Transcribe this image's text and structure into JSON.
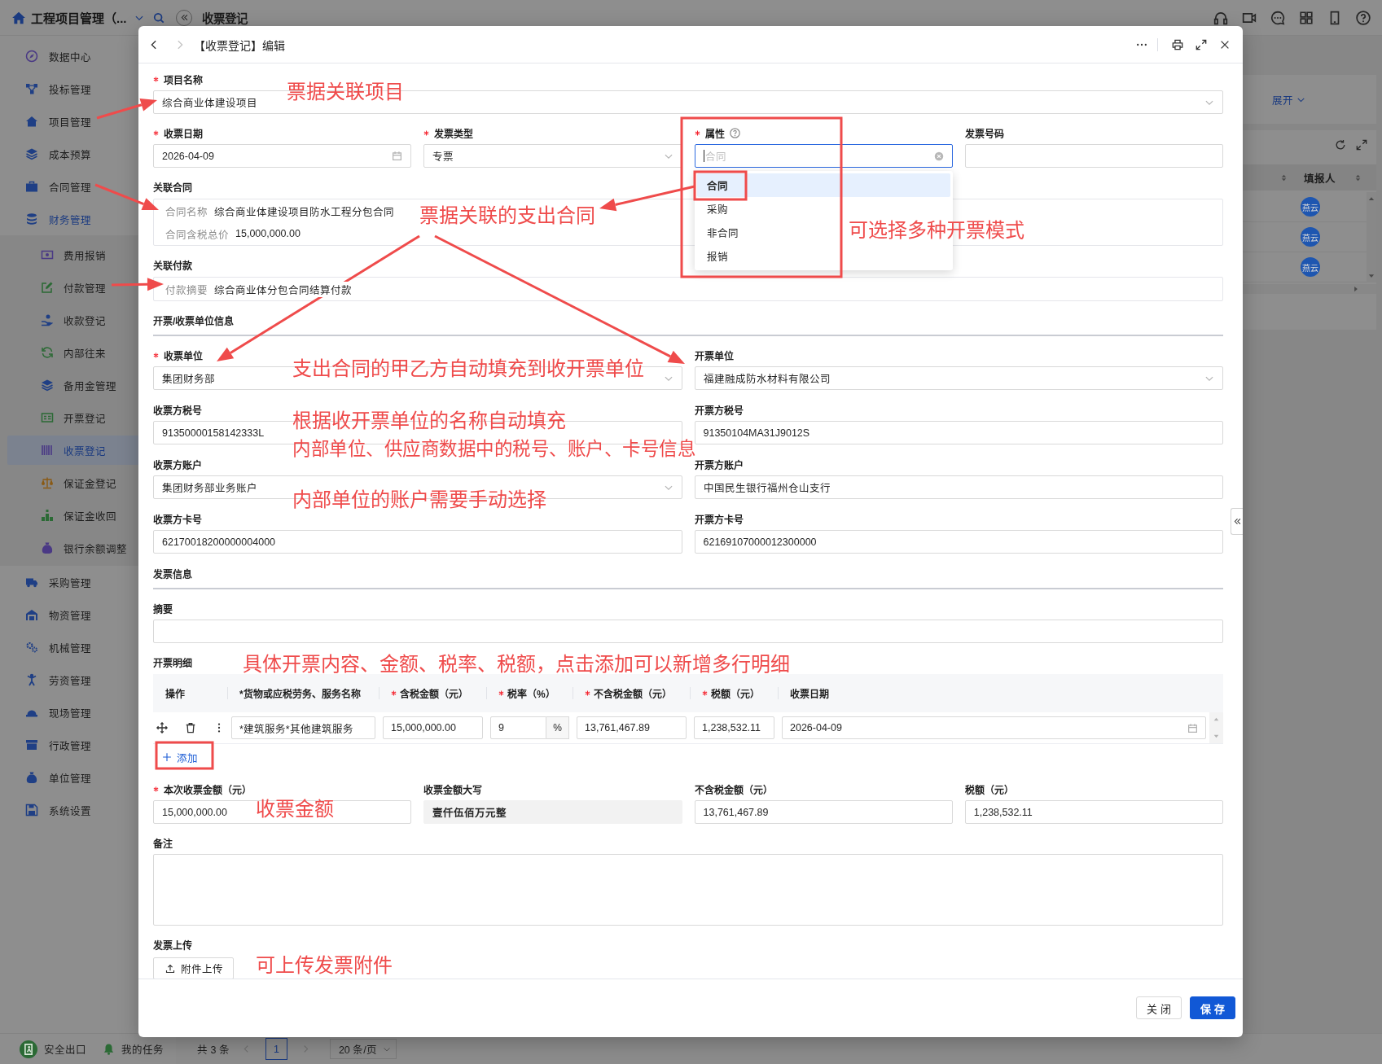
{
  "app": {
    "title": "工程项目管理（...",
    "page_title": "收票登记"
  },
  "sidebar": {
    "items": [
      {
        "label": "数据中心",
        "selected": false
      },
      {
        "label": "投标管理",
        "selected": false
      },
      {
        "label": "项目管理",
        "selected": false
      },
      {
        "label": "成本预算",
        "selected": false
      },
      {
        "label": "合同管理",
        "selected": false
      },
      {
        "label": "财务管理",
        "selected": false,
        "children": [
          {
            "label": "费用报销",
            "selected": false
          },
          {
            "label": "付款管理",
            "selected": false
          },
          {
            "label": "收款登记",
            "selected": false
          },
          {
            "label": "内部往来",
            "selected": false
          },
          {
            "label": "备用金管理",
            "selected": false
          },
          {
            "label": "开票登记",
            "selected": false
          },
          {
            "label": "收票登记",
            "selected": true
          },
          {
            "label": "保证金登记",
            "selected": false
          },
          {
            "label": "保证金收回",
            "selected": false
          },
          {
            "label": "银行余额调整",
            "selected": false
          }
        ]
      },
      {
        "label": "采购管理",
        "selected": false
      },
      {
        "label": "物资管理",
        "selected": false
      },
      {
        "label": "机械管理",
        "selected": false
      },
      {
        "label": "劳资管理",
        "selected": false
      },
      {
        "label": "现场管理",
        "selected": false
      },
      {
        "label": "行政管理",
        "selected": false
      },
      {
        "label": "单位管理",
        "selected": false
      },
      {
        "label": "系统设置",
        "selected": false
      }
    ],
    "footer": [
      {
        "label": "安全出口"
      },
      {
        "label": "我的任务"
      }
    ]
  },
  "list_page": {
    "filter_toggle": "展开",
    "table": {
      "columns": [
        {
          "label": "填报人"
        }
      ],
      "rows": [
        {
          "reporter": "燕云"
        },
        {
          "reporter": "燕云"
        },
        {
          "reporter": "燕云"
        }
      ]
    },
    "pagination": {
      "total": "共 3 条",
      "prev_disabled": true,
      "pages": [
        {
          "label": "1",
          "selected": true
        }
      ],
      "next_disabled": true,
      "page_size": "20 条/页"
    }
  },
  "dialog": {
    "title": "【收票登记】编辑",
    "history": [
      {
        "kind": "back",
        "disabled": false
      },
      {
        "kind": "forward",
        "disabled": true
      }
    ],
    "blocks": [
      {
        "kind": "fields",
        "fields": [
          {
            "kind": "select",
            "label": "项目名称",
            "required": true,
            "value": "综合商业体建设项目"
          }
        ]
      },
      {
        "kind": "fields",
        "fields": [
          {
            "kind": "date",
            "label": "收票日期",
            "required": true,
            "help": false,
            "value": "2026-04-09"
          },
          {
            "kind": "select",
            "label": "发票类型",
            "required": true,
            "help": false,
            "value": "专票"
          },
          {
            "kind": "search_select",
            "label": "属性",
            "required": true,
            "help": true,
            "placeholder": "合同",
            "focused": true,
            "open": true,
            "options": [
              {
                "label": "合同",
                "selected": true
              },
              {
                "label": "采购",
                "selected": false
              },
              {
                "label": "非合同",
                "selected": false
              },
              {
                "label": "报销",
                "selected": false
              }
            ]
          },
          {
            "kind": "text",
            "label": "发票号码",
            "required": false,
            "help": false
          }
        ]
      },
      {
        "kind": "info",
        "label": "关联合同",
        "items": [
          {
            "label": "合同名称",
            "value": "综合商业体建设项目防水工程分包合同"
          },
          {
            "label": "合同含税总价",
            "value": "15,000,000.00"
          }
        ]
      },
      {
        "kind": "info",
        "label": "关联付款",
        "items": [
          {
            "label": "付款摘要",
            "value": "综合商业体分包合同结算付款"
          }
        ]
      },
      {
        "kind": "section",
        "title": "开票/收票单位信息"
      },
      {
        "kind": "fields",
        "fields": [
          {
            "kind": "select",
            "label": "收票单位",
            "required": true,
            "value": "集团财务部"
          },
          {
            "kind": "select",
            "label": "开票单位",
            "required": false,
            "value": "福建融成防水材料有限公司"
          }
        ]
      },
      {
        "kind": "fields",
        "fields": [
          {
            "kind": "text",
            "label": "收票方税号",
            "required": false,
            "value": "91350000158142333L"
          },
          {
            "kind": "text",
            "label": "开票方税号",
            "required": false,
            "value": "91350104MA31J9012S"
          }
        ]
      },
      {
        "kind": "fields",
        "fields": [
          {
            "kind": "select",
            "label": "收票方账户",
            "required": false,
            "value": "集团财务部业务账户"
          },
          {
            "kind": "text",
            "label": "开票方账户",
            "required": false,
            "value": "中国民生银行福州仓山支行"
          }
        ]
      },
      {
        "kind": "fields",
        "fields": [
          {
            "kind": "text",
            "label": "收票方卡号",
            "required": false,
            "value": "62170018200000004000"
          },
          {
            "kind": "text",
            "label": "开票方卡号",
            "required": false,
            "value": "62169107000012300000"
          }
        ]
      },
      {
        "kind": "section",
        "title": "发票信息"
      },
      {
        "kind": "fields",
        "fields": [
          {
            "kind": "text",
            "label": "摘要",
            "required": false
          }
        ]
      },
      {
        "kind": "table",
        "label": "开票明细",
        "columns": [
          {
            "label": "操作",
            "required": false
          },
          {
            "label": "*货物或应税劳务、服务名称",
            "required": false
          },
          {
            "label": "含税金额（元）",
            "required": true
          },
          {
            "label": "税率（%）",
            "required": true
          },
          {
            "label": "不含税金额（元）",
            "required": true
          },
          {
            "label": "税额（元）",
            "required": true
          },
          {
            "label": "收票日期",
            "required": false
          }
        ],
        "rows": [
          {
            "name": "*建筑服务*其他建筑服务",
            "amount": "15,000,000.00",
            "rate": "9",
            "rate_unit": "%",
            "net_amount": "13,761,467.89",
            "tax": "1,238,532.11",
            "date": "2026-04-09"
          }
        ],
        "add_label": "添加"
      },
      {
        "kind": "fields",
        "fields": [
          {
            "kind": "text",
            "label": "本次收票金额（元）",
            "required": true,
            "value": "15,000,000.00"
          },
          {
            "kind": "readonly",
            "label": "收票金额大写",
            "required": false,
            "value": "壹仟伍佰万元整"
          },
          {
            "kind": "text",
            "label": "不含税金额（元）",
            "required": false,
            "value": "13,761,467.89"
          },
          {
            "kind": "text",
            "label": "税额（元）",
            "required": false,
            "value": "1,238,532.11"
          }
        ]
      },
      {
        "kind": "fields",
        "fields": [
          {
            "kind": "textarea",
            "label": "备注",
            "required": false
          }
        ]
      },
      {
        "kind": "upload",
        "label": "发票上传",
        "button": "附件上传"
      }
    ],
    "buttons": [
      {
        "label": "关闭",
        "kind": "default"
      },
      {
        "label": "保存",
        "kind": "primary"
      }
    ]
  },
  "annotations": [
    {
      "text": "票据关联项目"
    },
    {
      "text": "票据关联的支出合同"
    },
    {
      "text": "可选择多种开票模式"
    },
    {
      "text": "支出合同的甲乙方自动填充到收开票单位"
    },
    {
      "text": "根据收开票单位的名称自动填充"
    },
    {
      "text": "内部单位、供应商数据中的税号、账户、卡号信息"
    },
    {
      "text": "内部单位的账户需要手动选择"
    },
    {
      "text": "具体开票内容、金额、税率、税额，点击添加可以新增多行明细"
    },
    {
      "text": "收票金额"
    },
    {
      "text": "可上传发票附件"
    }
  ]
}
